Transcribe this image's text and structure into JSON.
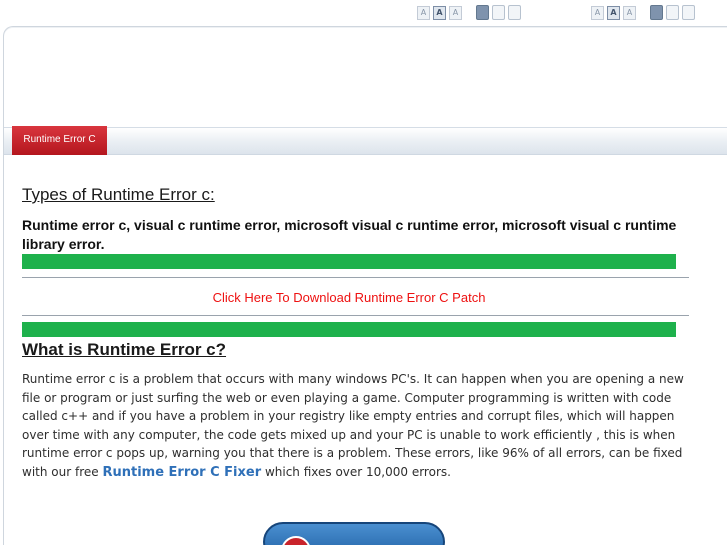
{
  "toolbar_left": {
    "font_buttons": [
      "A",
      "A",
      "A"
    ],
    "active_font_index": 1
  },
  "toolbar_right": {
    "font_buttons": [
      "A",
      "A",
      "A"
    ],
    "active_font_index": 1
  },
  "nav": {
    "active_tab": "Runtime Error C"
  },
  "types": {
    "heading": "Types of Runtime Error c:",
    "text": "Runtime error c, visual c runtime error, microsoft visual c runtime error, microsoft visual c runtime library error."
  },
  "download_link": "Click Here To Download Runtime Error C Patch",
  "what": {
    "heading": "What is Runtime Error c?",
    "body_before": "Runtime error c is a problem that occurs with many windows PC's. It can happen when you are opening a new file or program or just surfing the web or even playing a game. Computer programming is written with code called c++ and if you have a problem in your registry like empty entries and corrupt files, which will happen over time with any computer, the code gets mixed up and your PC is unable to work efficiently , this is when runtime error c pops up, warning you that there is a problem. These errors, like 96% of all errors, can be fixed with our free ",
    "fixer_link": "Runtime Error C Fixer",
    "body_after": " which fixes over 10,000 errors."
  },
  "colors": {
    "green_bar": "#1eb14c",
    "tab_red": "#c42129",
    "link_red": "#ee1111",
    "link_blue": "#2f70b8"
  }
}
